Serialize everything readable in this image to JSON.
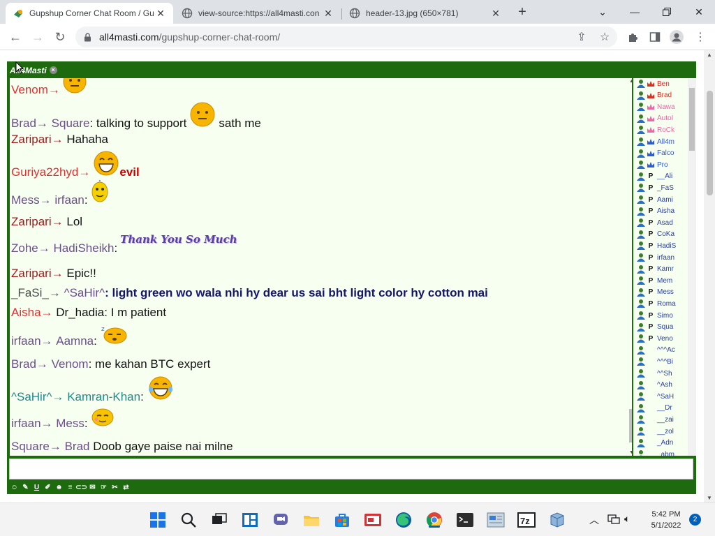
{
  "browser": {
    "tabs": [
      {
        "title": "Gupshup Corner Chat Room / Gu",
        "active": true
      },
      {
        "title": "view-source:https://all4masti.con",
        "active": false
      },
      {
        "title": "header-13.jpg (650×781)",
        "active": false
      }
    ],
    "url_host": "all4masti.com",
    "url_path": "/gupshup-corner-chat-room/"
  },
  "chat": {
    "room_tab": "All4Masti",
    "messages": [
      {
        "from": "Venom",
        "arrow": "→",
        "to": "",
        "text": "",
        "emoji": "neutral-face"
      },
      {
        "from": "Brad",
        "arrow": "→",
        "to": "Square",
        "text_pre": ": talking to support",
        "text_post": "sath me",
        "emoji": "neutral-face"
      },
      {
        "from": "Zaripari",
        "arrow": "→",
        "text": "Hahaha"
      },
      {
        "from": "Guriya22hyd",
        "arrow": "→",
        "text": "evil",
        "emoji": "grin-face"
      },
      {
        "from": "Mess",
        "arrow": "→",
        "to": "irfaan",
        "text": ":",
        "emoji": "thinking-face"
      },
      {
        "from": "Zaripari",
        "arrow": "→",
        "text": "Lol"
      },
      {
        "from": "Zohe",
        "arrow": "→",
        "to": "HadiSheikh",
        "text": ":",
        "sticker": "Thank You So Much"
      },
      {
        "from": "Zaripari",
        "arrow": "→",
        "text": "Epic!!"
      },
      {
        "from": "_FaSi_",
        "arrow": "→",
        "to": "^SaHir^",
        "text": ": light green wo wala nhi hy dear us sai bht light color hy cotton mai"
      },
      {
        "from": "Aisha",
        "arrow": "→",
        "text": "Dr_hadia: I m patient"
      },
      {
        "from": "irfaan",
        "arrow": "→",
        "to": "Aamna",
        "text": ":",
        "emoji": "sleep-face"
      },
      {
        "from": "Brad",
        "arrow": "→",
        "to": "Venom",
        "text": ": me kahan BTC expert"
      },
      {
        "from": "^SaHir^",
        "arrow": "→",
        "to": "Kamran-Khan",
        "text": ":",
        "emoji": "laugh-face"
      },
      {
        "from": "irfaan",
        "arrow": "→",
        "to": "Mess",
        "text": ":",
        "emoji": "blush-face"
      },
      {
        "from": "Square",
        "arrow": "→",
        "to": "Brad",
        "text": "Doob gaye paise nai milne"
      }
    ],
    "users": [
      {
        "name": "Ben",
        "rank": "crown-red"
      },
      {
        "name": "Brad",
        "rank": "crown-red"
      },
      {
        "name": "Nawa",
        "rank": "crown-pink"
      },
      {
        "name": "AutoI",
        "rank": "crown-pink"
      },
      {
        "name": "RoCk",
        "rank": "crown-pink"
      },
      {
        "name": "All4m",
        "rank": "crown-blue"
      },
      {
        "name": "Falco",
        "rank": "crown-blue"
      },
      {
        "name": "Pro",
        "rank": "crown-blue"
      },
      {
        "name": "__Ali",
        "rank": "p"
      },
      {
        "name": "_FaS",
        "rank": "p"
      },
      {
        "name": "Aami",
        "rank": "p"
      },
      {
        "name": "Aisha",
        "rank": "p"
      },
      {
        "name": "Asad",
        "rank": "p"
      },
      {
        "name": "CoKa",
        "rank": "p"
      },
      {
        "name": "HadiS",
        "rank": "p"
      },
      {
        "name": "irfaan",
        "rank": "p"
      },
      {
        "name": "Kamr",
        "rank": "p"
      },
      {
        "name": "Mem",
        "rank": "p"
      },
      {
        "name": "Mess",
        "rank": "p"
      },
      {
        "name": "Roma",
        "rank": "p"
      },
      {
        "name": "Simo",
        "rank": "p"
      },
      {
        "name": "Squa",
        "rank": "p"
      },
      {
        "name": "Veno",
        "rank": "p"
      },
      {
        "name": "^^^Ac",
        "rank": ""
      },
      {
        "name": "^^^Bi",
        "rank": ""
      },
      {
        "name": "^^Sh",
        "rank": ""
      },
      {
        "name": "^Ash",
        "rank": ""
      },
      {
        "name": "^SaH",
        "rank": ""
      },
      {
        "name": "__Dr",
        "rank": ""
      },
      {
        "name": "__zai",
        "rank": ""
      },
      {
        "name": "__zol",
        "rank": ""
      },
      {
        "name": "_Adn",
        "rank": ""
      },
      {
        "name": "_abm",
        "rank": ""
      }
    ]
  },
  "taskbar": {
    "time": "5:42 PM",
    "date": "5/1/2022",
    "notifications": "2"
  },
  "colors": {
    "frame_green": "#1e6b0f",
    "chat_bg": "#f7fff0"
  }
}
